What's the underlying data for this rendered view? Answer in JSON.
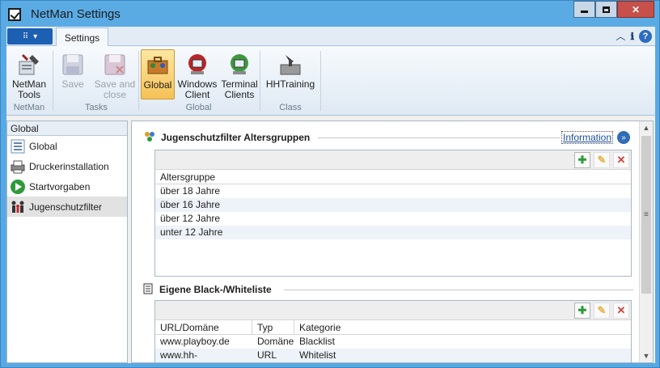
{
  "window": {
    "title": "NetMan Settings"
  },
  "ribbon": {
    "tab": "Settings",
    "groups": [
      {
        "label": "NetMan",
        "buttons": [
          {
            "label": "NetMan Tools"
          }
        ]
      },
      {
        "label": "Tasks",
        "buttons": [
          {
            "label": "Save"
          },
          {
            "label": "Save and close"
          }
        ]
      },
      {
        "label": "Global",
        "buttons": [
          {
            "label": "Global"
          },
          {
            "label": "Windows Client"
          },
          {
            "label": "Terminal Clients"
          }
        ]
      },
      {
        "label": "Class",
        "buttons": [
          {
            "label": "HHTraining"
          }
        ]
      }
    ]
  },
  "left_panel": {
    "header": "Global",
    "items": [
      {
        "label": "Global"
      },
      {
        "label": "Druckerinstallation"
      },
      {
        "label": "Startvorgaben"
      },
      {
        "label": "Jugenschutzfilter"
      }
    ]
  },
  "section1": {
    "title": "Jugenschutzfilter Altersgruppen",
    "info_link": "Information",
    "column": "Altersgruppe",
    "rows": [
      "über 18 Jahre",
      "über 16 Jahre",
      "über 12 Jahre",
      "unter 12 Jahre"
    ]
  },
  "section2": {
    "title": "Eigene Black-/Whiteliste",
    "columns": [
      "URL/Domäne",
      "Typ",
      "Kategorie"
    ],
    "rows": [
      [
        "www.playboy.de",
        "Domäne",
        "Blacklist"
      ],
      [
        "www.hh-software.com",
        "URL",
        "Whitelist"
      ]
    ]
  },
  "colors": {
    "titlebar": "#5aabe4",
    "active_button": "#f6c155",
    "link": "#1e4fa0",
    "close": "#c7504a"
  }
}
